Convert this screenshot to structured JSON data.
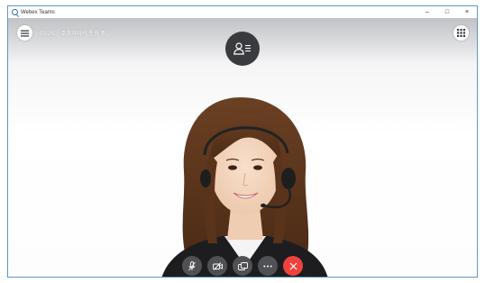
{
  "window": {
    "title": "Webex Teams",
    "controls": {
      "minimize": "–",
      "maximize": "□",
      "close": "×"
    }
  },
  "meeting": {
    "time": "00:25",
    "info": "주최자와의 통화 중..."
  },
  "icons": {
    "app": "webex-icon",
    "menu": "hamburger-icon",
    "participants": "participants-icon",
    "layout": "grid-icon",
    "mute": "microphone-icon",
    "video": "video-off-icon",
    "share": "share-screen-icon",
    "more": "more-icon",
    "end": "close-icon"
  },
  "colors": {
    "accent": "#2f6fb3",
    "control_bg": "#505154",
    "end_call": "#f0423d",
    "participants_bg": "#3a3b3e"
  }
}
